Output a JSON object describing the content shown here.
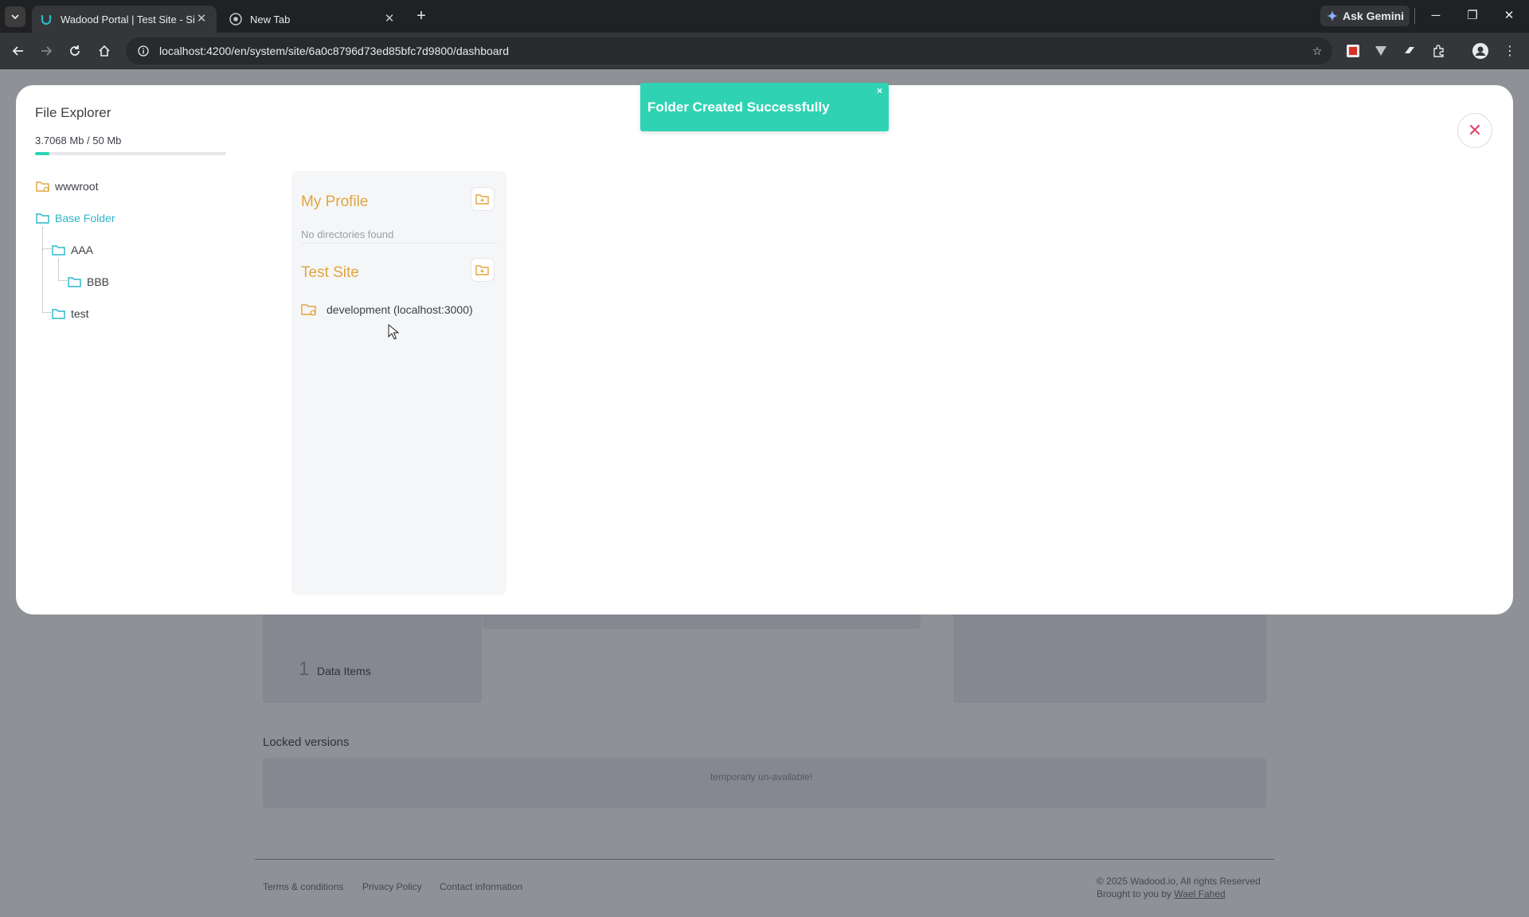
{
  "browser": {
    "tabs": [
      {
        "title": "Wadood Portal | Test Site - Site"
      },
      {
        "title": "New Tab"
      }
    ],
    "gemini_label": "Ask Gemini",
    "url": "localhost:4200/en/system/site/6a0c8796d73ed85bfc7d9800/dashboard"
  },
  "background_page": {
    "data_items_count": "1",
    "data_items_label": "Data Items",
    "locked_versions_heading": "Locked versions",
    "locked_versions_note": "temporarly un-available!",
    "footer": {
      "links": [
        "Terms & conditions",
        "Privacy Policy",
        "Contact information"
      ],
      "copyright": "© 2025 Wadood.io, All rights Reserved",
      "brought_by_prefix": "Brought to you by",
      "brought_by_name": "Wael Fahed"
    }
  },
  "modal": {
    "title": "File Explorer",
    "quota_used": "3.7068 Mb",
    "quota_sep": " / ",
    "quota_total": "50 Mb",
    "quota_fraction": 0.074,
    "tree": [
      {
        "label": "wwwroot"
      },
      {
        "label": "Base Folder"
      },
      {
        "label": "AAA"
      },
      {
        "label": "BBB"
      },
      {
        "label": "test"
      }
    ],
    "panel": {
      "sections": [
        {
          "title": "My Profile",
          "empty_text": "No directories found"
        },
        {
          "title": "Test Site",
          "items": [
            {
              "label": "development (localhost:3000)"
            }
          ]
        }
      ]
    }
  },
  "toast": {
    "message": "Folder Created Successfully",
    "close": "×"
  },
  "colors": {
    "accent_teal": "#2ab7c7",
    "toast_green": "#2fd3b4",
    "section_orange": "#e0a63c",
    "close_pink": "#e0466b"
  }
}
